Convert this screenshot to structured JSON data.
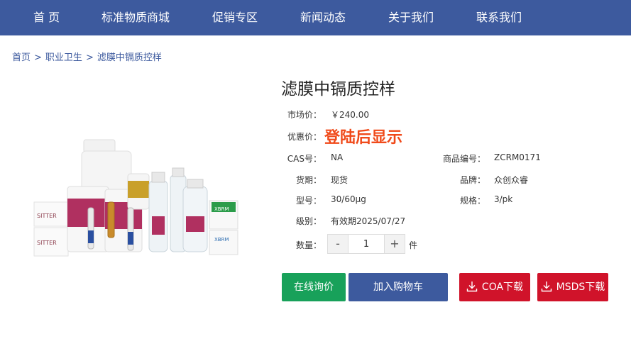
{
  "nav": {
    "items": [
      "首 页",
      "标准物质商城",
      "促销专区",
      "新闻动态",
      "关于我们",
      "联系我们"
    ]
  },
  "breadcrumb": {
    "home": "首页",
    "category": "职业卫生",
    "current": "滤膜中镉质控样",
    "separator": ">"
  },
  "product": {
    "title": "滤膜中镉质控样",
    "market_price_label": "市场价：",
    "market_price": "￥240.00",
    "promo_price_label": "优惠价：",
    "promo_price": "登陆后显示",
    "cas_label": "CAS号：",
    "cas": "NA",
    "code_label": "商品编号：",
    "code": "ZCRM0171",
    "stock_label": "货期：",
    "stock": "现货",
    "brand_label": "品牌：",
    "brand": "众创众睿",
    "model_label": "型号：",
    "model": "30/60μg",
    "spec_label": "规格：",
    "spec": "3/pk",
    "grade_label": "级别：",
    "grade": "有效期2025/07/27",
    "qty_label": "数量：",
    "qty": "1",
    "qty_unit": "件",
    "minus": "-",
    "plus": "+"
  },
  "image_labels": {
    "brand_left": "SITTER",
    "brand_right": "XBRM"
  },
  "buttons": {
    "inquiry": "在线询价",
    "cart": "加入购物车",
    "coa": "COA下载",
    "msds": "MSDS下载"
  },
  "colors": {
    "nav_bg": "#3d5a9e",
    "promo_text": "#f04a1a",
    "inquiry_bg": "#18a15a",
    "cart_bg": "#3d5a9e",
    "download_bg": "#d0132a"
  },
  "icons": {
    "download": "download-icon"
  }
}
